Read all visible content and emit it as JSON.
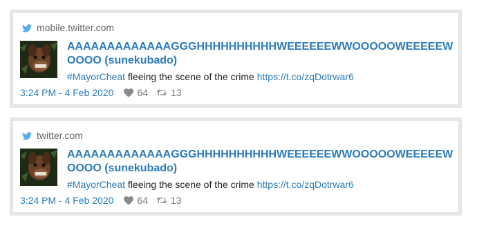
{
  "colors": {
    "link": "#2b7bb9",
    "border": "#e6e6e6",
    "muted": "#777777"
  },
  "tweets": [
    {
      "source": "mobile.twitter.com",
      "source_icon": "twitter-bird-icon",
      "author_line": "AAAAAAAAAAAAAGGGHHHHHHHHHHWEEEEEEWWOOOOOWEEEEEWOOOO (sunekubado)",
      "hashtag": "#MayorCheat",
      "text": " fleeing the scene of the crime ",
      "link": "https://t.co/zqDotrwar6",
      "date": "3:24 PM - 4 Feb 2020",
      "likes": "64",
      "retweets": "13"
    },
    {
      "source": "twitter.com",
      "source_icon": "twitter-bird-icon",
      "author_line": "AAAAAAAAAAAAAGGGHHHHHHHHHHWEEEEEEWWOOOOOWEEEEEWOOOO (sunekubado)",
      "hashtag": "#MayorCheat",
      "text": " fleeing the scene of the crime ",
      "link": "https://t.co/zqDotrwar6",
      "date": "3:24 PM - 4 Feb 2020",
      "likes": "64",
      "retweets": "13"
    }
  ]
}
